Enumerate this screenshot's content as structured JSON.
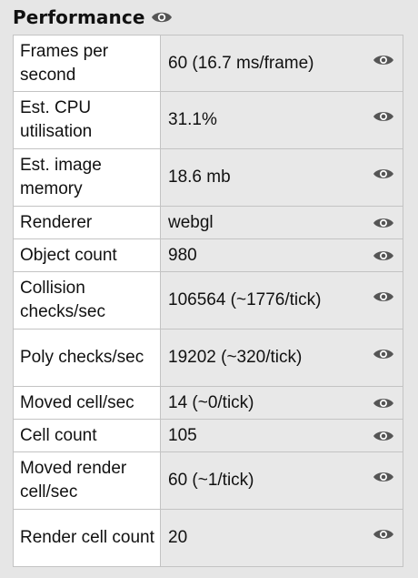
{
  "panel": {
    "title": "Performance",
    "title_icon": "eye-icon"
  },
  "rows": [
    {
      "label": "Frames per second",
      "value": "60 (16.7 ms/frame)",
      "icon": "eye-icon"
    },
    {
      "label": "Est. CPU utilisation",
      "value": "31.1%",
      "icon": "eye-icon"
    },
    {
      "label": "Est. image memory",
      "value": "18.6 mb",
      "icon": "eye-icon"
    },
    {
      "label": "Renderer",
      "value": "webgl",
      "icon": "eye-icon"
    },
    {
      "label": "Object count",
      "value": "980",
      "icon": "eye-icon"
    },
    {
      "label": "Collision checks/sec",
      "value": "106564 (~1776/tick)",
      "icon": "eye-icon"
    },
    {
      "label": "Poly checks/sec",
      "value": "19202 (~320/tick)",
      "icon": "eye-icon"
    },
    {
      "label": "Moved cell/sec",
      "value": "14 (~0/tick)",
      "icon": "eye-icon"
    },
    {
      "label": "Cell count",
      "value": "105",
      "icon": "eye-icon"
    },
    {
      "label": "Moved render cell/sec",
      "value": "60 (~1/tick)",
      "icon": "eye-icon"
    },
    {
      "label": "Render cell count",
      "value": "20",
      "icon": "eye-icon"
    }
  ],
  "colors": {
    "background": "#e6e6e6",
    "label_cell": "#ffffff",
    "value_cell": "#e8e8e8",
    "border": "#c3c3c3",
    "icon": "#555555"
  }
}
